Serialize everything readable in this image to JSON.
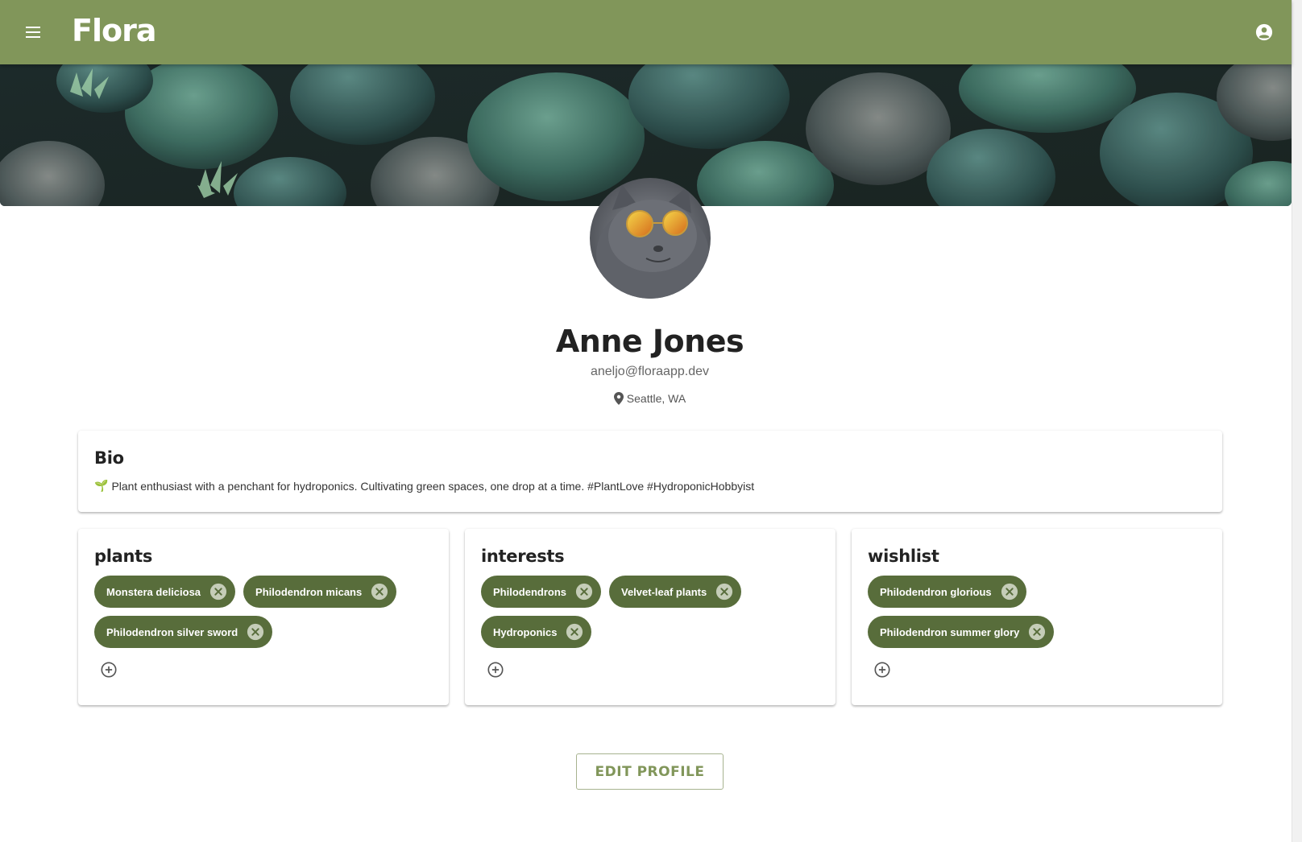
{
  "app": {
    "logo": "Flora"
  },
  "profile": {
    "name": "Anne Jones",
    "email": "aneljo@floraapp.dev",
    "location": "Seattle, WA"
  },
  "bio": {
    "title": "Bio",
    "emoji": "🌱",
    "text": "Plant enthusiast with a penchant for hydroponics. Cultivating green spaces, one drop at a time. #PlantLove #HydroponicHobbyist"
  },
  "plants": {
    "title": "plants",
    "items": [
      "Monstera deliciosa",
      "Philodendron micans",
      "Philodendron silver sword"
    ]
  },
  "interests": {
    "title": "interests",
    "items": [
      "Philodendrons",
      "Velvet-leaf plants",
      "Hydroponics"
    ]
  },
  "wishlist": {
    "title": "wishlist",
    "items": [
      "Philodendron glorious",
      "Philodendron summer glory"
    ]
  },
  "actions": {
    "edit_profile": "EDIT PROFILE"
  },
  "icons": {
    "menu": "menu-icon",
    "account": "account-circle-icon",
    "location": "location-pin-icon",
    "chip_remove": "close-circle-icon",
    "add": "add-circle-icon"
  },
  "colors": {
    "app_bar": "#81965a",
    "chip": "#586d3b",
    "accent": "#81965a"
  }
}
